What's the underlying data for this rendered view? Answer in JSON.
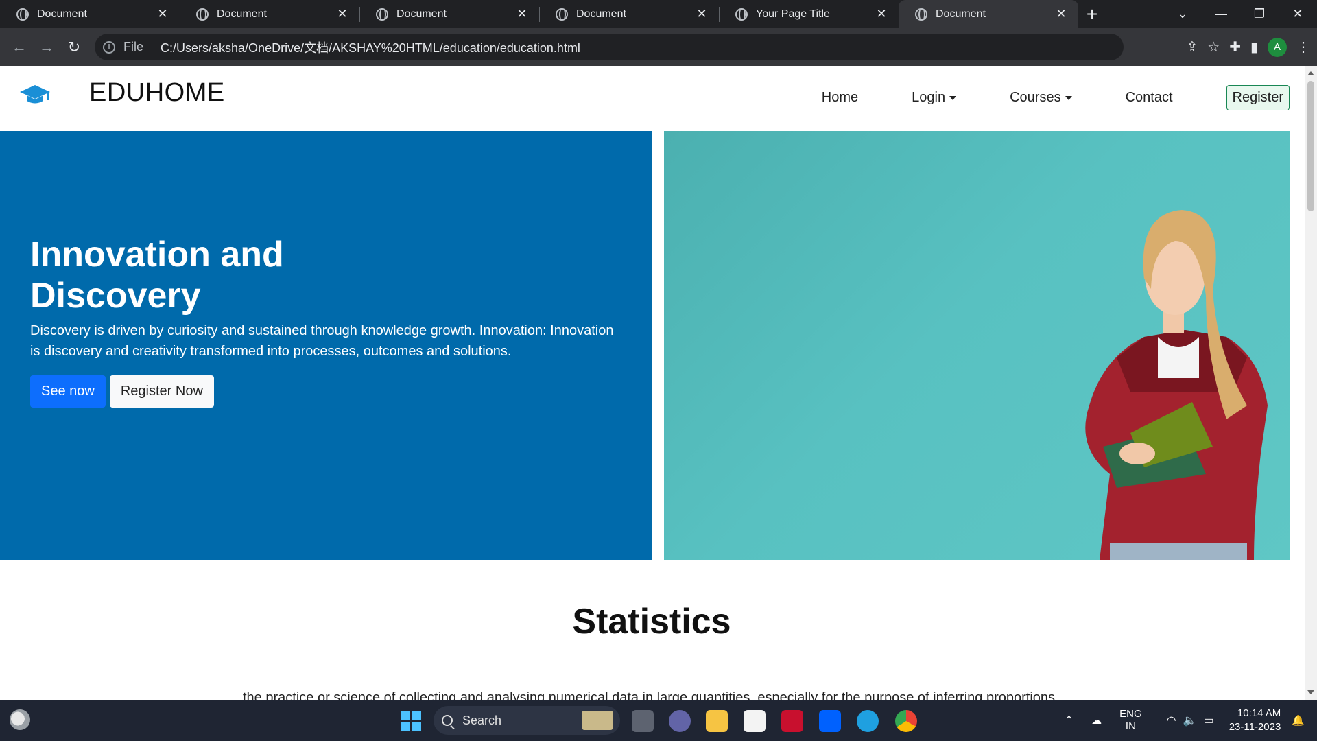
{
  "browser": {
    "tabs": [
      {
        "title": "Document",
        "active": false
      },
      {
        "title": "Document",
        "active": false
      },
      {
        "title": "Document",
        "active": false
      },
      {
        "title": "Document",
        "active": false
      },
      {
        "title": "Your Page Title",
        "active": false
      },
      {
        "title": "Document",
        "active": true
      }
    ],
    "new_tab_symbol": "+",
    "close_symbol": "✕",
    "address": {
      "scheme_label": "File",
      "url": "C:/Users/aksha/OneDrive/文档/AKSHAY%20HTML/education/education.html"
    },
    "profile_initial": "A"
  },
  "site": {
    "brand": "EDUHOME",
    "nav": {
      "home": "Home",
      "login": "Login",
      "courses": "Courses",
      "contact": "Contact",
      "register": "Register"
    },
    "hero": {
      "title_line1": "Innovation and",
      "title_line2": "Discovery",
      "text": "Discovery is driven by curiosity and sustained through knowledge growth. Innovation: Innovation is discovery and creativity transformed into processes, outcomes and solutions.",
      "primary_button": "See now",
      "secondary_button": "Register Now"
    },
    "stats": {
      "title": "Statistics",
      "text": "the practice or science of collecting and analysing numerical data in large quantities, especially for the purpose of inferring proportions"
    }
  },
  "taskbar": {
    "search_label": "Search",
    "language_line1": "ENG",
    "language_line2": "IN",
    "time": "10:14 AM",
    "date": "23-11-2023"
  },
  "colors": {
    "hero_left_bg": "#006aab",
    "hero_right_bg": "#55bdbc",
    "primary_button": "#0d6efd",
    "register_border": "#198754"
  }
}
